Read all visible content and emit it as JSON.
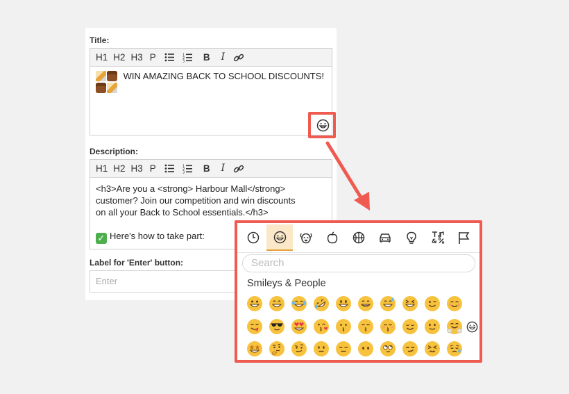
{
  "toolbar": {
    "h1": "H1",
    "h2": "H2",
    "h3": "H3",
    "p": "P",
    "bold": "B",
    "italic": "I",
    "icons": [
      "bullet-list-icon",
      "numbered-list-icon",
      "link-icon"
    ]
  },
  "title_field": {
    "label": "Title:",
    "text": "WIN AMAZING BACK TO SCHOOL DISCOUNTS!"
  },
  "description_field": {
    "label": "Description:",
    "line1": "<h3>Are you a <strong> Harbour Mall</strong>",
    "line2": "customer? Join our competition and win discounts",
    "line3": "on all your Back to School essentials.</h3>",
    "line4": "Here's how to take part:"
  },
  "enter_field": {
    "label": "Label for 'Enter' button:",
    "placeholder": "Enter"
  },
  "emoji_picker": {
    "tabs": [
      "recent-icon",
      "smileys-icon",
      "animals-icon",
      "food-icon",
      "activity-icon",
      "travel-icon",
      "objects-icon",
      "symbols-icon",
      "flags-icon"
    ],
    "active_tab": "smileys-icon",
    "search_placeholder": "Search",
    "category": "Smileys & People"
  },
  "colors": {
    "highlight": "#ef5b51",
    "active_tab": "#fbe8c8",
    "emoji_yellow": "#f7c23e"
  }
}
